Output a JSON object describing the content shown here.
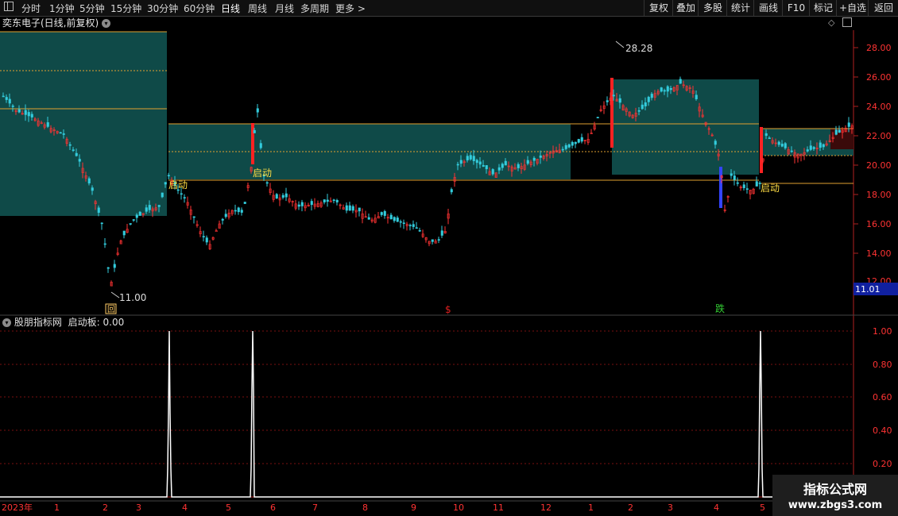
{
  "toolbar": {
    "menu_icon": "square-menu-icon",
    "periods": [
      "分时",
      "1分钟",
      "5分钟",
      "15分钟",
      "30分钟",
      "60分钟",
      "日线",
      "周线",
      "月线",
      "多周期",
      "更多 >"
    ],
    "active_period": "日线",
    "right_buttons": [
      "复权",
      "叠加",
      "多股",
      "统计",
      "画线",
      "F10",
      "标记",
      "+自选",
      "返回"
    ]
  },
  "main_chart": {
    "title": "奕东电子(日线,前复权)",
    "high_label": "28.28",
    "low_label": "11.00",
    "current_price": "11.01",
    "signal_label": "启动",
    "markers": [
      {
        "text": "回",
        "color": "#ffcc66"
      },
      {
        "text": "$",
        "color": "#e02020"
      },
      {
        "text": "跌",
        "color": "#33cc33"
      }
    ],
    "y_ticks": [
      "28.00",
      "26.00",
      "24.00",
      "22.00",
      "20.00",
      "18.00",
      "16.00",
      "14.00",
      "12.00"
    ],
    "colors": {
      "up": "#ff3333",
      "down": "#33ccdd",
      "box": "#0f4a48",
      "line": "#e0a030"
    }
  },
  "indicator": {
    "name": "股朋指标网",
    "param": "启动板: 0.00",
    "y_ticks": [
      "1.00",
      "0.80",
      "0.60",
      "0.40",
      "0.20"
    ]
  },
  "x_axis": [
    "2023年",
    "1",
    "2",
    "3",
    "4",
    "5",
    "6",
    "7",
    "8",
    "9",
    "10",
    "11",
    "12",
    "1",
    "2",
    "3",
    "4",
    "5"
  ],
  "watermark": {
    "line1": "指标公式网",
    "line2": "www.zbgs3.com"
  }
}
